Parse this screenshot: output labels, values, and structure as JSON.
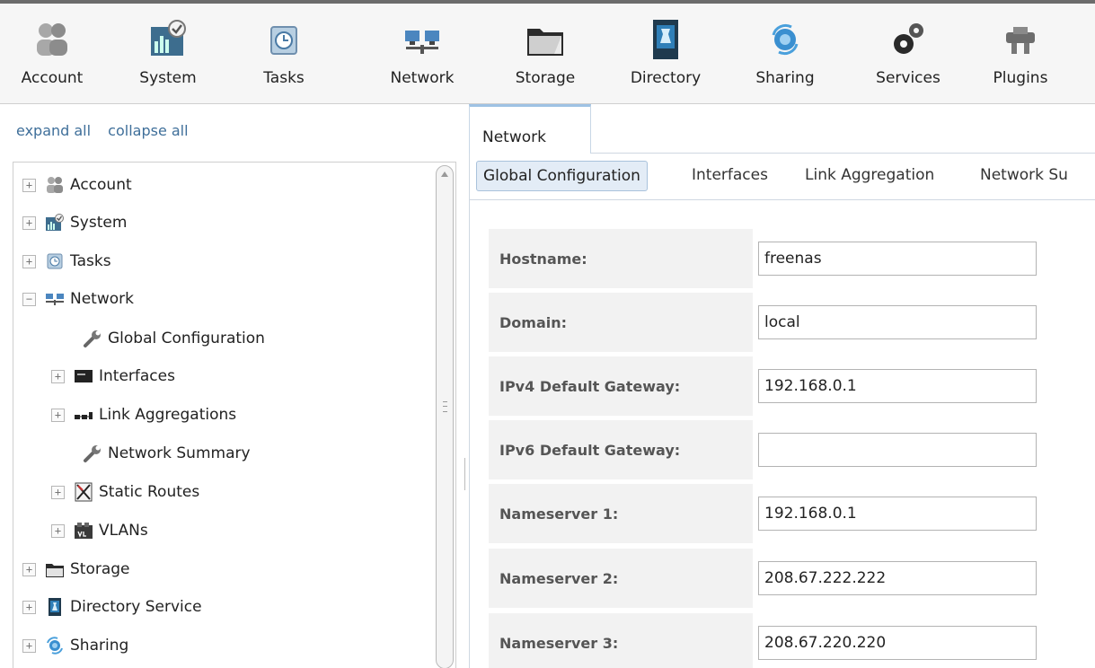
{
  "toolbar": {
    "items": [
      {
        "label": "Account",
        "icon": "account-icon"
      },
      {
        "label": "System",
        "icon": "system-icon"
      },
      {
        "label": "Tasks",
        "icon": "tasks-icon"
      },
      {
        "label": "Network",
        "icon": "network-icon"
      },
      {
        "label": "Storage",
        "icon": "storage-icon"
      },
      {
        "label": "Directory",
        "icon": "directory-icon"
      },
      {
        "label": "Sharing",
        "icon": "sharing-icon"
      },
      {
        "label": "Services",
        "icon": "services-icon"
      },
      {
        "label": "Plugins",
        "icon": "plugins-icon"
      }
    ]
  },
  "nav": {
    "expand_all": "expand all",
    "collapse_all": "collapse all",
    "tree": [
      {
        "label": "Account",
        "expander": "+",
        "icon": "account-icon"
      },
      {
        "label": "System",
        "expander": "+",
        "icon": "system-icon"
      },
      {
        "label": "Tasks",
        "expander": "+",
        "icon": "tasks-icon"
      },
      {
        "label": "Network",
        "expander": "−",
        "icon": "network-icon"
      },
      {
        "label": "Global Configuration",
        "expander": "",
        "icon": "wrench-icon"
      },
      {
        "label": "Interfaces",
        "expander": "+",
        "icon": "interfaces-icon"
      },
      {
        "label": "Link Aggregations",
        "expander": "+",
        "icon": "link-aggregation-icon"
      },
      {
        "label": "Network Summary",
        "expander": "",
        "icon": "wrench-icon"
      },
      {
        "label": "Static Routes",
        "expander": "+",
        "icon": "static-routes-icon"
      },
      {
        "label": "VLANs",
        "expander": "+",
        "icon": "vlan-icon"
      },
      {
        "label": "Storage",
        "expander": "+",
        "icon": "storage-icon"
      },
      {
        "label": "Directory Service",
        "expander": "+",
        "icon": "directory-icon"
      },
      {
        "label": "Sharing",
        "expander": "+",
        "icon": "sharing-icon"
      }
    ]
  },
  "content": {
    "tab": "Network",
    "subtabs": [
      "Global Configuration",
      "Interfaces",
      "Link Aggregation",
      "Network Su"
    ],
    "active_subtab": "Global Configuration",
    "form": [
      {
        "label": "Hostname:",
        "value": "freenas"
      },
      {
        "label": "Domain:",
        "value": "local"
      },
      {
        "label": "IPv4 Default Gateway:",
        "value": "192.168.0.1"
      },
      {
        "label": "IPv6 Default Gateway:",
        "value": ""
      },
      {
        "label": "Nameserver 1:",
        "value": "192.168.0.1"
      },
      {
        "label": "Nameserver 2:",
        "value": "208.67.222.222"
      },
      {
        "label": "Nameserver 3:",
        "value": "208.67.220.220"
      }
    ]
  },
  "colors": {
    "link": "#3f6f9a",
    "active_subtab_bg": "#e3ecf6",
    "label_bg": "#f2f2f2"
  }
}
